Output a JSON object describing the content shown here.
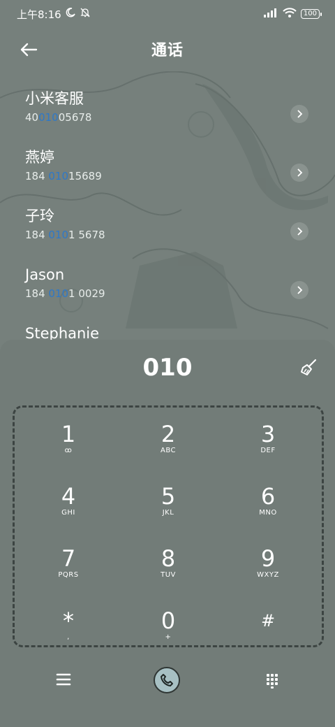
{
  "status": {
    "time": "上午8:16",
    "battery": "100"
  },
  "header": {
    "title": "通话"
  },
  "contacts": [
    {
      "name": "小米客服",
      "num_pre": "40",
      "num_hl": "010",
      "num_post": "05678"
    },
    {
      "name": "燕婷",
      "num_pre": "184 ",
      "num_hl": "010",
      "num_post": "15689"
    },
    {
      "name": "子玲",
      "num_pre": "184 ",
      "num_hl": "010",
      "num_post": "1 5678"
    },
    {
      "name": "Jason",
      "num_pre": "184 ",
      "num_hl": "010",
      "num_post": "1 0029"
    },
    {
      "name": "Stephanie",
      "num_pre": "",
      "num_hl": "",
      "num_post": ""
    }
  ],
  "dialer": {
    "typed": "010",
    "keys": [
      {
        "d": "1",
        "l": "ꝏ"
      },
      {
        "d": "2",
        "l": "ABC"
      },
      {
        "d": "3",
        "l": "DEF"
      },
      {
        "d": "4",
        "l": "GHI"
      },
      {
        "d": "5",
        "l": "JKL"
      },
      {
        "d": "6",
        "l": "MNO"
      },
      {
        "d": "7",
        "l": "PQRS"
      },
      {
        "d": "8",
        "l": "TUV"
      },
      {
        "d": "9",
        "l": "WXYZ"
      },
      {
        "d": "*",
        "l": ","
      },
      {
        "d": "0",
        "l": "+"
      },
      {
        "d": "#",
        "l": ""
      }
    ]
  },
  "colors": {
    "background": "#76807c",
    "highlight": "#2e78c8",
    "call_button": "#a7c0c3"
  },
  "icons": [
    "back-arrow-icon",
    "moon-icon",
    "mute-icon",
    "signal-icon",
    "wifi-icon",
    "chevron-right-icon",
    "broom-icon",
    "menu-icon",
    "phone-icon",
    "dialpad-icon"
  ]
}
